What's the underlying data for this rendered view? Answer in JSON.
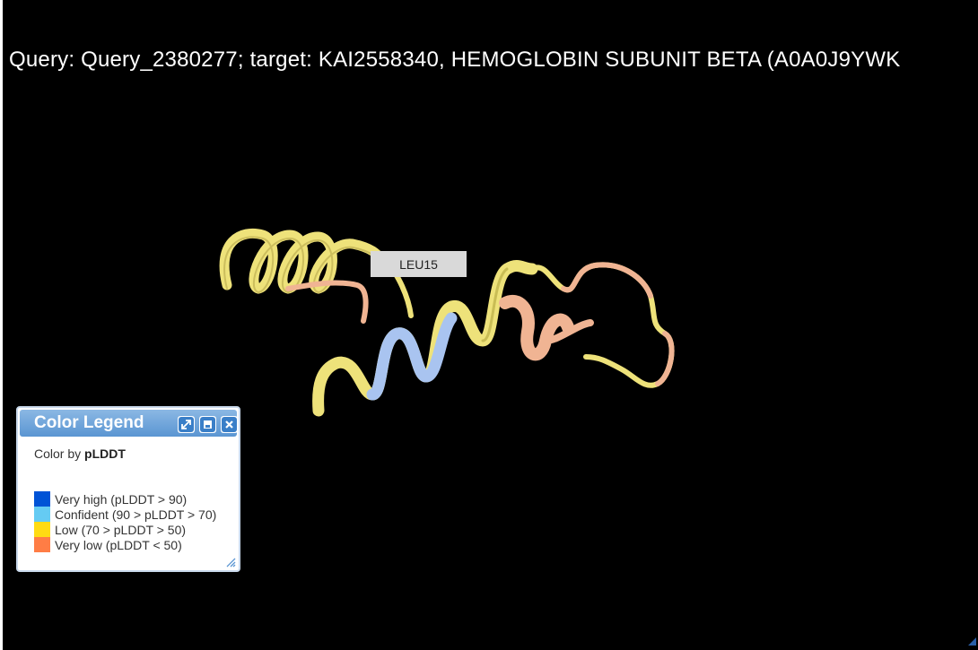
{
  "viewer": {
    "title": "Query: Query_2380277; target: KAI2558340, HEMOGLOBIN SUBUNIT BETA (A0A0J9YWK",
    "residue_label": "LEU15",
    "background": "#000000"
  },
  "legend": {
    "title": "Color Legend",
    "color_by_prefix": "Color by ",
    "color_by_value": "pLDDT",
    "items": [
      {
        "label": "Very high (pLDDT > 90)",
        "color": "#0053d6"
      },
      {
        "label": "Confident (90 > pLDDT > 70)",
        "color": "#65cbf3"
      },
      {
        "label": "Low (70 > pLDDT > 50)",
        "color": "#ffdb13"
      },
      {
        "label": "Very low (pLDDT < 50)",
        "color": "#ff7d45"
      }
    ],
    "buttons": [
      "expand-icon",
      "minimize-icon",
      "close-icon"
    ]
  },
  "structure_colors": {
    "low": "#eee27a",
    "very_low": "#f0b493",
    "confident": "#a9c4f0"
  }
}
